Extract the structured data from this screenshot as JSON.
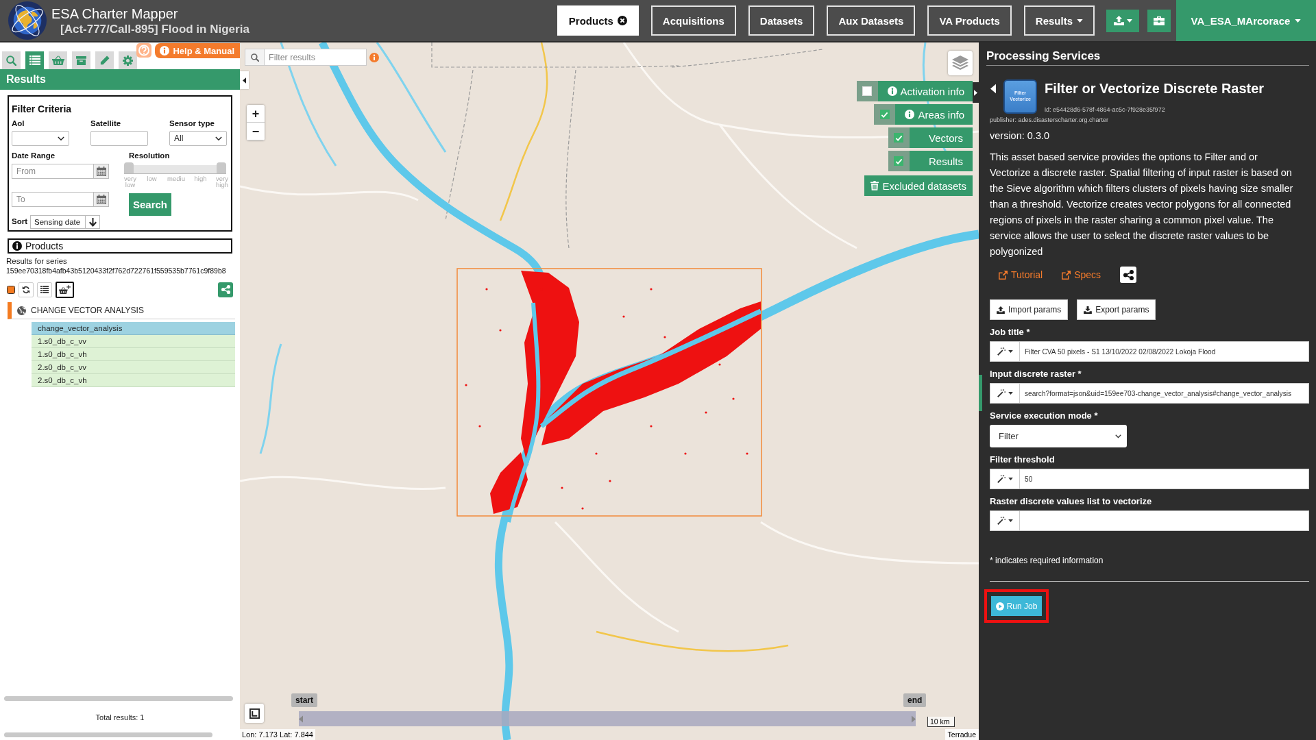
{
  "header": {
    "app_title": "ESA Charter Mapper",
    "subtitle": "[Act-777/Call-895] Flood in Nigeria",
    "nav": [
      {
        "label": "Products",
        "selected": true,
        "closable": true,
        "dropdown": false
      },
      {
        "label": "Acquisitions",
        "selected": false,
        "closable": false,
        "dropdown": false
      },
      {
        "label": "Datasets",
        "selected": false,
        "closable": false,
        "dropdown": false
      },
      {
        "label": "Aux Datasets",
        "selected": false,
        "closable": false,
        "dropdown": false
      },
      {
        "label": "VA Products",
        "selected": false,
        "closable": false,
        "dropdown": false
      },
      {
        "label": "Results",
        "selected": false,
        "closable": false,
        "dropdown": true
      }
    ],
    "user": "VA_ESA_MArcorace"
  },
  "sidebar": {
    "tabs": [
      {
        "selected": false
      },
      {
        "selected": true
      },
      {
        "selected": false
      },
      {
        "selected": false
      },
      {
        "selected": false
      },
      {
        "selected": false
      }
    ],
    "help": "Help & Manual",
    "title": "Results",
    "filter": {
      "title": "Filter Criteria",
      "aoi": {
        "label": "AoI"
      },
      "satellite": {
        "label": "Satellite"
      },
      "sensor_type": {
        "label": "Sensor type",
        "value": "All"
      },
      "date_range": {
        "label": "Date Range",
        "from": {
          "placeholder": "From"
        },
        "to": {
          "placeholder": "To"
        }
      },
      "resolution": {
        "label": "Resolution",
        "ticks": [
          "very low",
          "low",
          "mediu",
          "high",
          "very high"
        ],
        "min_thumb": {
          "level": 0
        },
        "max_thumb": {
          "level": 1
        }
      },
      "search_button": "Search",
      "sort": {
        "label": "Sort",
        "value": "Sensing date"
      }
    },
    "products": {
      "title": "Products",
      "series_label": "Results for series",
      "series_id": "159ee70318fb4afb43b5120433f2f762d722761f559535b7761c9f89b8"
    },
    "tree": [
      {
        "label": "CHANGE VECTOR ANALYSIS",
        "children": [
          {
            "label": "change_vector_analysis",
            "selected": true
          },
          {
            "label": "1.s0_db_c_vv",
            "selected": false
          },
          {
            "label": "1.s0_db_c_vh",
            "selected": false
          },
          {
            "label": "2.s0_db_c_vv",
            "selected": false
          },
          {
            "label": "2.s0_db_c_vh",
            "selected": false
          }
        ]
      }
    ],
    "total": "Total results: 1"
  },
  "map": {
    "filter": {
      "placeholder": "Filter results"
    },
    "zoom": [
      "+",
      "−"
    ],
    "layers": [
      {
        "label": "Activation info",
        "checked": false,
        "info": true
      },
      {
        "label": "Areas info",
        "checked": true,
        "info": true
      },
      {
        "label": "Vectors",
        "checked": true,
        "info": false
      },
      {
        "label": "Results",
        "checked": true,
        "info": false
      }
    ],
    "excluded": "Excluded datasets",
    "timeline": {
      "start": "start",
      "end": "end"
    },
    "coordinates": "Lon: 7.173 Lat: 7.844",
    "scale": "10 km",
    "attribution": "Terradue"
  },
  "processing": {
    "title": "Processing Services",
    "service": {
      "icon_lines": [
        "Filter",
        "Vectorize"
      ],
      "name": "Filter or Vectorize Discrete Raster",
      "id": "id: e54428d6-578f-4864-ac5c-7f928e35f972",
      "publisher": "publisher: ades.disasterscharter.org.charter",
      "version": "version: 0.3.0",
      "description": "This asset based service provides the options to Filter and or Vectorize a discrete raster. Spatial filtering of input raster is based on the Sieve algorithm which filters clusters of pixels having size smaller than a threshold. Vectorize creates vector polygons for all connected regions of pixels in the raster sharing a common pixel value. The service allows the user to select the discrete raster values to be polygonized",
      "links": [
        "Tutorial",
        "Specs"
      ]
    },
    "import": "Import params",
    "export": "Export params",
    "fields": [
      {
        "kind": "text",
        "label": "Job title *",
        "value": "Filter CVA 50 pixels - S1 13/10/2022 02/08/2022 Lokoja Flood"
      },
      {
        "kind": "text",
        "label": "Input discrete raster *",
        "value": "search?format=json&uid=159ee703-change_vector_analysis#change_vector_analysis"
      },
      {
        "kind": "select",
        "label": "Service execution mode *",
        "value": "Filter"
      },
      {
        "kind": "text",
        "label": "Filter threshold",
        "value": "50"
      },
      {
        "kind": "text",
        "label": "Raster discrete values list to vectorize"
      }
    ],
    "note": "* indicates required information",
    "run_job": {
      "label": "Run Job",
      "highlighted": true
    }
  }
}
